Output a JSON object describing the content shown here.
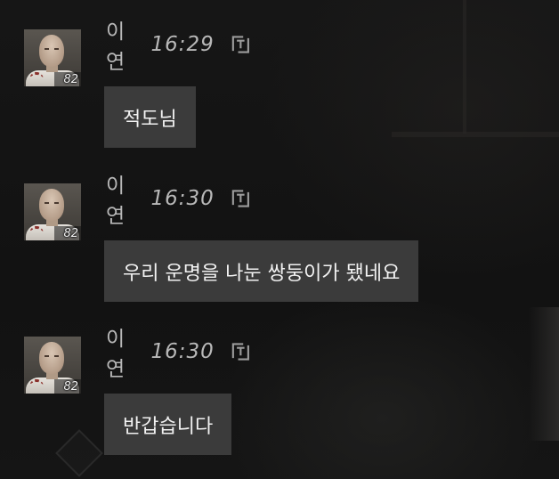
{
  "chat": {
    "messages": [
      {
        "sender": "이연",
        "time": "16:29",
        "level": "82",
        "text": "적도님",
        "translate_icon": "translate-t-icon"
      },
      {
        "sender": "이연",
        "time": "16:30",
        "level": "82",
        "text": "우리 운명을 나눈 쌍둥이가 됐네요",
        "translate_icon": "translate-t-icon"
      },
      {
        "sender": "이연",
        "time": "16:30",
        "level": "82",
        "text": "반갑습니다",
        "translate_icon": "translate-t-icon"
      }
    ]
  },
  "colors": {
    "background": "#141414",
    "bubble": "#3b3b3b",
    "meta_text": "#b8b8b8",
    "message_text": "#f2f2f2"
  }
}
